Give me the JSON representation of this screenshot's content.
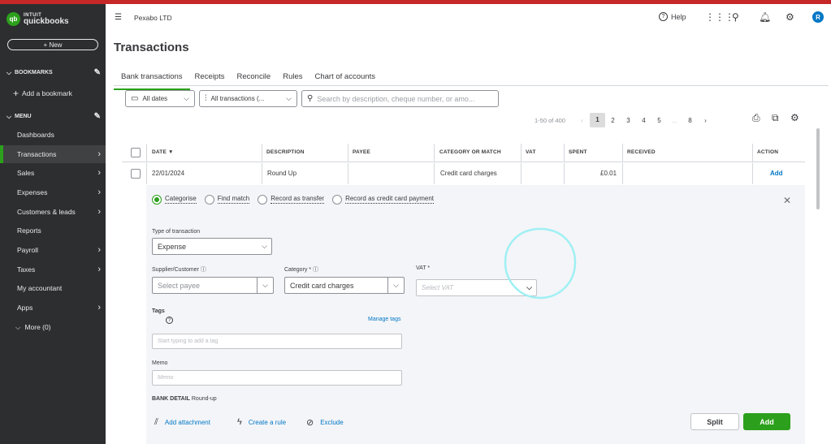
{
  "brand": {
    "logo_mark": "qb",
    "logo_line1": "INTUIT",
    "logo_line2": "quickbooks",
    "accent": "#2ca01c",
    "top_stripe": "#c62828"
  },
  "sidebar": {
    "new_label": "New",
    "bookmarks_label": "BOOKMARKS",
    "add_bookmark": "Add a bookmark",
    "menu_label": "MENU",
    "items": [
      {
        "label": "Dashboards"
      },
      {
        "label": "Transactions"
      },
      {
        "label": "Sales"
      },
      {
        "label": "Expenses"
      },
      {
        "label": "Customers & leads"
      },
      {
        "label": "Reports"
      },
      {
        "label": "Payroll"
      },
      {
        "label": "Taxes"
      },
      {
        "label": "My accountant"
      },
      {
        "label": "Apps"
      }
    ],
    "more_label": "More (0)"
  },
  "header": {
    "company": "Pexabo LTD",
    "help": "Help",
    "avatar": "R"
  },
  "page": {
    "title": "Transactions"
  },
  "tabs": [
    "Bank transactions",
    "Receipts",
    "Reconcile",
    "Rules",
    "Chart of accounts"
  ],
  "filters": {
    "dates": "All dates",
    "types": "All transactions (...",
    "search_placeholder": "Search by description, cheque number, or amo..."
  },
  "pager": {
    "range": "1-50 of 400",
    "prev": "‹",
    "pages": [
      "1",
      "2",
      "3",
      "4",
      "5"
    ],
    "ellipsis": "...",
    "last": "8",
    "next": "›"
  },
  "table": {
    "headers": [
      "DATE ▼",
      "DESCRIPTION",
      "PAYEE",
      "CATEGORY OR MATCH",
      "VAT",
      "SPENT",
      "RECEIVED",
      "ACTION"
    ],
    "row": {
      "date": "22/01/2024",
      "description": "Round Up",
      "payee": "",
      "category": "Credit card charges",
      "vat": "",
      "spent": "£0.01",
      "received": "",
      "action": "Add"
    }
  },
  "panel": {
    "radios": [
      "Categorise",
      "Find match",
      "Record as transfer",
      "Record as credit card payment"
    ],
    "type_label": "Type of transaction",
    "type_value": "Expense",
    "supplier_label": "Supplier/Customer",
    "supplier_placeholder": "Select payee",
    "category_label": "Category *",
    "category_value": "Credit card charges",
    "vat_label": "VAT *",
    "vat_placeholder": "Select VAT",
    "tags_label": "Tags",
    "manage_tags": "Manage tags",
    "tags_placeholder": "Start typing to add a tag",
    "memo_label": "Memo",
    "memo_placeholder": "Memo",
    "bank_detail_label": "BANK DETAIL",
    "bank_detail_value": "Round-up",
    "add_attachment": "Add attachment",
    "create_rule": "Create a rule",
    "exclude": "Exclude",
    "split": "Split",
    "add": "Add"
  }
}
